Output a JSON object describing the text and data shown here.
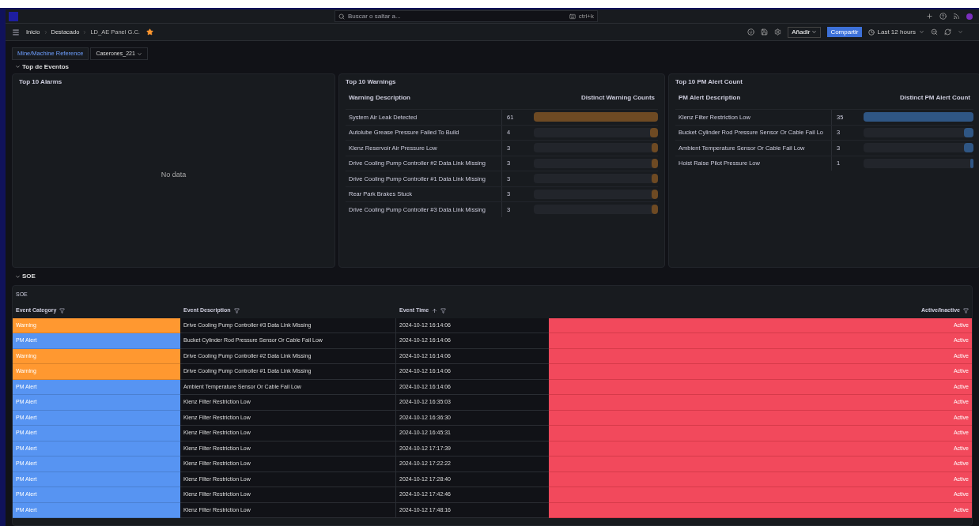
{
  "topbar": {
    "search_placeholder": "Buscar o saltar a...",
    "shortcut": "ctrl+k"
  },
  "breadcrumbs": [
    {
      "label": "Inicio"
    },
    {
      "label": "Destacado"
    },
    {
      "label": "LD_AE Panel G.C."
    }
  ],
  "starred": true,
  "toolbar": {
    "add": "Añadir",
    "share": "Compartir",
    "time_range": "Last 12 hours"
  },
  "variables": {
    "label": "Mine/Machine Reference",
    "value": "Caserones_221"
  },
  "rows": [
    {
      "title": "Top de Eventos",
      "expanded": true
    },
    {
      "title": "SOE",
      "expanded": true
    }
  ],
  "alarms_panel": {
    "title": "Top 10 Alarms",
    "empty": "No data"
  },
  "warnings_panel": {
    "title": "Top 10 Warnings",
    "columns": [
      "Warning Description",
      "Distinct Warning Counts"
    ],
    "items": [
      {
        "label": "System Air Leak Detected",
        "value": "61",
        "level": 1
      },
      {
        "label": "Autolube Grease Pressure Failed To Build",
        "value": "4",
        "level": 0.066
      },
      {
        "label": "Klenz Reservoir Air Pressure Low",
        "value": "3",
        "level": 0.049
      },
      {
        "label": "Drive Cooling Pump Controller #2 Data Link Missing",
        "value": "3",
        "level": 0.049
      },
      {
        "label": "Drive Cooling Pump Controller #1 Data Link Missing",
        "value": "3",
        "level": 0.049
      },
      {
        "label": "Rear Park Brakes Stuck",
        "value": "3",
        "level": 0.049
      },
      {
        "label": "Drive Cooling Pump Controller #3 Data Link Missing",
        "value": "3",
        "level": 0.049
      }
    ]
  },
  "pm_panel": {
    "title": "Top 10 PM Alert Count",
    "columns": [
      "PM Alert Description",
      "Distinct PM Alert Count"
    ],
    "items": [
      {
        "label": "Klenz Filter Restriction Low",
        "value": "35",
        "level": 1
      },
      {
        "label": "Bucket Cylinder Rod Pressure Sensor Or Cable Fail Lo",
        "value": "3",
        "level": 0.086
      },
      {
        "label": "Ambient Temperature Sensor Or Cable Fail Low",
        "value": "3",
        "level": 0.086
      },
      {
        "label": "Hoist Raise Pilot Pressure Low",
        "value": "1",
        "level": 0.029
      }
    ]
  },
  "soe": {
    "title": "SOE",
    "columns": [
      "Event Category",
      "Event Description",
      "Event Time",
      "Active/Inactive"
    ],
    "rows": [
      {
        "category": "Warning",
        "color": "#ff9830",
        "description": "Drive Cooling Pump Controller #3 Data Link Missing",
        "time": "2024-10-12 16:14:06",
        "status": "Active",
        "active": true
      },
      {
        "category": "PM Alert",
        "color": "#5794f2",
        "description": "Bucket Cylinder Rod Pressure Sensor Or Cable Fail Low",
        "time": "2024-10-12 16:14:06",
        "status": "Active",
        "active": true
      },
      {
        "category": "Warning",
        "color": "#ff9830",
        "description": "Drive Cooling Pump Controller #2 Data Link Missing",
        "time": "2024-10-12 16:14:06",
        "status": "Active",
        "active": true
      },
      {
        "category": "Warning",
        "color": "#ff9830",
        "description": "Drive Cooling Pump Controller #1 Data Link Missing",
        "time": "2024-10-12 16:14:06",
        "status": "Active",
        "active": true
      },
      {
        "category": "PM Alert",
        "color": "#5794f2",
        "description": "Ambient Temperature Sensor Or Cable Fail Low",
        "time": "2024-10-12 16:14:06",
        "status": "Active",
        "active": true
      },
      {
        "category": "PM Alert",
        "color": "#5794f2",
        "description": "Klenz Filter Restriction Low",
        "time": "2024-10-12 16:35:03",
        "status": "Active",
        "active": true
      },
      {
        "category": "PM Alert",
        "color": "#5794f2",
        "description": "Klenz Filter Restriction Low",
        "time": "2024-10-12 16:36:30",
        "status": "Active",
        "active": true
      },
      {
        "category": "PM Alert",
        "color": "#5794f2",
        "description": "Klenz Filter Restriction Low",
        "time": "2024-10-12 16:45:31",
        "status": "Active",
        "active": true
      },
      {
        "category": "PM Alert",
        "color": "#5794f2",
        "description": "Klenz Filter Restriction Low",
        "time": "2024-10-12 17:17:39",
        "status": "Active",
        "active": true
      },
      {
        "category": "PM Alert",
        "color": "#5794f2",
        "description": "Klenz Filter Restriction Low",
        "time": "2024-10-12 17:22:22",
        "status": "Active",
        "active": true
      },
      {
        "category": "PM Alert",
        "color": "#5794f2",
        "description": "Klenz Filter Restriction Low",
        "time": "2024-10-12 17:28:40",
        "status": "Active",
        "active": true
      },
      {
        "category": "PM Alert",
        "color": "#5794f2",
        "description": "Klenz Filter Restriction Low",
        "time": "2024-10-12 17:42:46",
        "status": "Active",
        "active": true
      },
      {
        "category": "PM Alert",
        "color": "#5794f2",
        "description": "Klenz Filter Restriction Low",
        "time": "2024-10-12 17:48:16",
        "status": "Active",
        "active": true
      }
    ]
  }
}
